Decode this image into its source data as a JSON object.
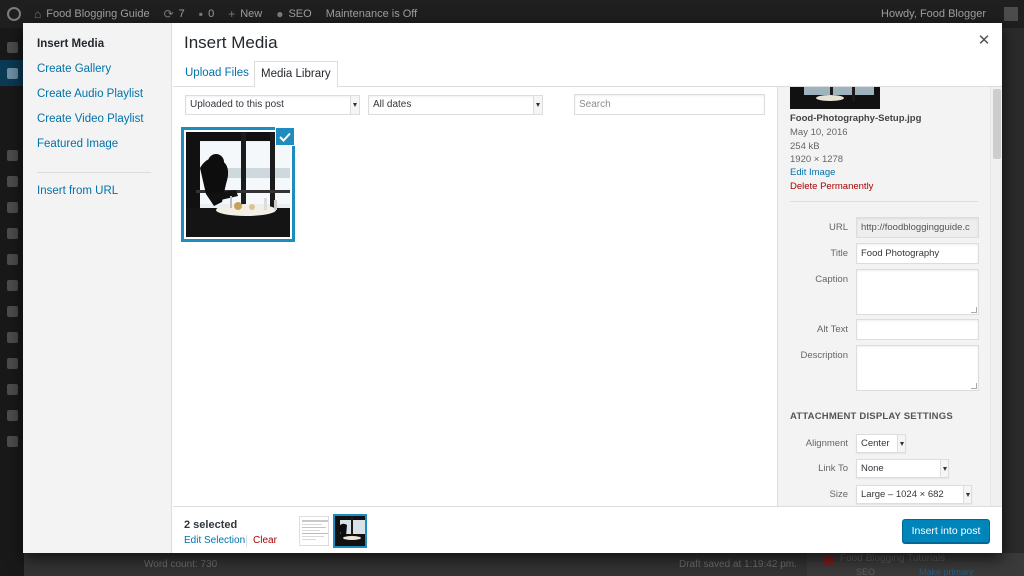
{
  "admin_bar": {
    "site_name": "Food Blogging Guide",
    "updates_count": "7",
    "comments_count": "0",
    "new_label": "New",
    "seo_label": "SEO",
    "maintenance_label": "Maintenance is Off",
    "howdy": "Howdy, Food Blogger"
  },
  "background": {
    "word_count": "Word count: 730",
    "draft_saved": "Draft saved at 1:19:42 pm.",
    "category_label": "Food Blogging Tutorials",
    "seo_label": "SEO",
    "make_primary": "Make primary"
  },
  "modal": {
    "title": "Insert Media",
    "close_icon": "close-icon"
  },
  "menu": {
    "items": [
      {
        "label": "Insert Media",
        "active": true
      },
      {
        "label": "Create Gallery"
      },
      {
        "label": "Create Audio Playlist"
      },
      {
        "label": "Create Video Playlist"
      },
      {
        "label": "Featured Image"
      }
    ],
    "url_item": "Insert from URL"
  },
  "router": {
    "tabs": [
      {
        "label": "Upload Files"
      },
      {
        "label": "Media Library",
        "active": true
      }
    ]
  },
  "filters": {
    "type_selected": "Uploaded to this post",
    "date_selected": "All dates",
    "search_placeholder": "Search"
  },
  "details": {
    "filename": "Food-Photography-Setup.jpg",
    "date": "May 10, 2016",
    "filesize": "254 kB",
    "dimensions": "1920 × 1278",
    "edit_image": "Edit Image",
    "delete_permanently": "Delete Permanently",
    "fields": {
      "url_label": "URL",
      "url_value": "http://foodbloggingguide.c",
      "title_label": "Title",
      "title_value": "Food Photography",
      "caption_label": "Caption",
      "caption_value": "",
      "alt_label": "Alt Text",
      "alt_value": "",
      "description_label": "Description",
      "description_value": ""
    }
  },
  "display_settings": {
    "heading": "Attachment Display Settings",
    "alignment_label": "Alignment",
    "alignment_value": "Center",
    "link_label": "Link To",
    "link_value": "None",
    "size_label": "Size",
    "size_value": "Large – 1024 × 682"
  },
  "toolbar": {
    "selected_count": "2 selected",
    "edit_selection": "Edit Selection",
    "clear": "Clear",
    "insert_button": "Insert into post"
  },
  "colors": {
    "accent": "#0073aa",
    "selection_border": "#1e8cbe",
    "primary_button": "#0085ba",
    "danger": "#a00"
  }
}
